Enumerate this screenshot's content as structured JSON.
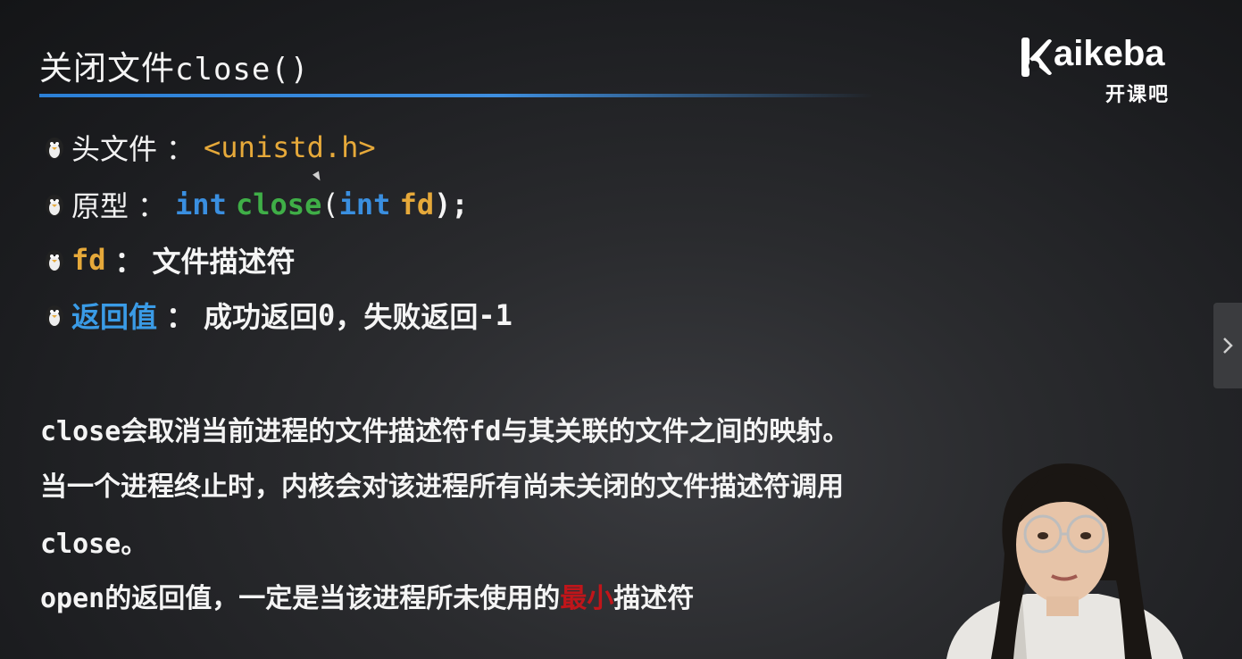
{
  "slide": {
    "title_cn": "关闭文件",
    "title_code": "close()"
  },
  "logo": {
    "brand": "aikeba",
    "subtitle": "开课吧"
  },
  "bullets": [
    {
      "label": "头文件",
      "sep": "：",
      "value": "<unistd.h>"
    },
    {
      "label": "原型",
      "sep": "：",
      "kw1": "int",
      "fn": "close",
      "paren_open": "(",
      "kw2": "int",
      "arg": "fd",
      "tail": ");"
    },
    {
      "label": "fd",
      "sep": "：",
      "value": "文件描述符"
    },
    {
      "label": "返回值",
      "sep": "：",
      "value_a": "成功返回",
      "zero": "0",
      "value_b": "，失败返回",
      "neg": "-1"
    }
  ],
  "paragraphs": {
    "line1_code": "close",
    "line1_a": "会取消当前进程的文件描述符",
    "line1_fd": "fd",
    "line1_b": "与其关联的文件之间的映射。",
    "line2": "当一个进程终止时，内核会对该进程所有尚未关闭的文件描述符调用",
    "line3_code": "close",
    "line3_tail": "。",
    "line4_code": "open",
    "line4_a": "的返回值，一定是当该进程所未使用的",
    "line4_red": "最小",
    "line4_b": "描述符"
  },
  "nav": {
    "next_icon": "chevron-right-icon"
  },
  "colors": {
    "accent_blue": "#3a8fe0",
    "code_orange": "#e6a93a",
    "code_green": "#3fae47",
    "highlight_red": "#c0151a"
  }
}
